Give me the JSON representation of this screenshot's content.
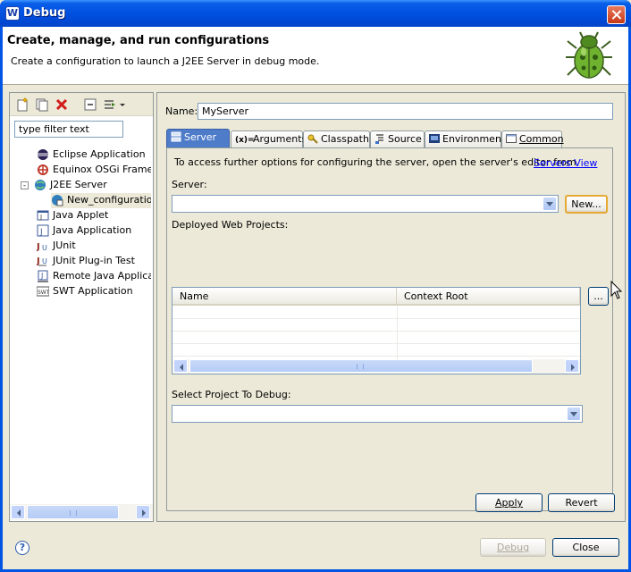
{
  "window": {
    "title": "Debug",
    "app_icon": "W"
  },
  "header": {
    "title": "Create, manage, and run configurations",
    "description": "Create a configuration to launch a J2EE Server in debug mode."
  },
  "left": {
    "filter_text": "type filter text",
    "tree": [
      {
        "label": "Eclipse Application",
        "icon": "eclipse-icon"
      },
      {
        "label": "Equinox OSGi Framewo",
        "icon": "osgi-icon"
      },
      {
        "label": "J2EE Server",
        "icon": "j2ee-server-icon",
        "expanded": "-"
      },
      {
        "label": "New_configuration",
        "icon": "server-config-icon"
      },
      {
        "label": "Java Applet",
        "icon": "java-applet-icon"
      },
      {
        "label": "Java Application",
        "icon": "java-application-icon"
      },
      {
        "label": "JUnit",
        "icon": "junit-icon"
      },
      {
        "label": "JUnit Plug-in Test",
        "icon": "junit-plugin-icon"
      },
      {
        "label": "Remote Java Applicatio",
        "icon": "remote-java-icon"
      },
      {
        "label": "SWT Application",
        "icon": "swt-icon"
      }
    ]
  },
  "form": {
    "name_label": "Name:",
    "name_value": "MyServer",
    "tabs": [
      {
        "label": "Server",
        "icon": "server-icon"
      },
      {
        "label": "Arguments",
        "icon": "arguments-icon"
      },
      {
        "label": "Classpath",
        "icon": "classpath-icon"
      },
      {
        "label": "Source",
        "icon": "source-icon"
      },
      {
        "label": "Environment",
        "icon": "environment-icon"
      },
      {
        "label": "Common",
        "icon": "common-icon"
      }
    ],
    "info_text": "To access further options for configuring the server, open the server's editor from",
    "servers_view_link": "Servers View",
    "server_label": "Server:",
    "server_value": "",
    "new_button": "New...",
    "deployed_label": "Deployed Web Projects:",
    "columns": [
      "Name",
      "Context Root"
    ],
    "ellipsis_button": "...",
    "select_project_label": "Select Project To Debug:",
    "select_project_value": "",
    "apply_button": "Apply",
    "revert_button": "Revert"
  },
  "footer": {
    "debug_button": "Debug",
    "close_button": "Close",
    "help_glyph": "?"
  },
  "colors": {
    "titlebar": "#0055e5",
    "active_tab": "#4f7cc9",
    "link": "#0000ff"
  }
}
